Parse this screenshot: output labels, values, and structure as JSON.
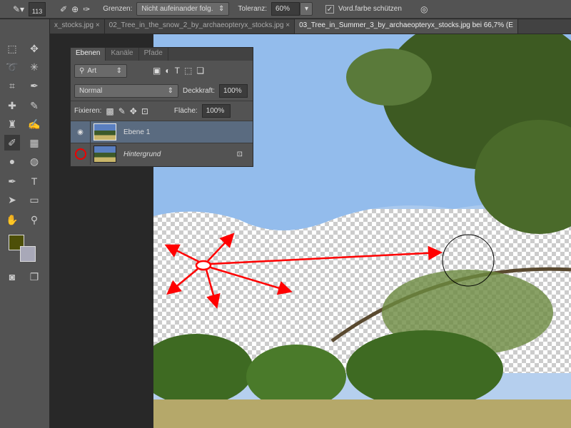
{
  "options_bar": {
    "brush_size": "113",
    "grenzen_label": "Grenzen:",
    "grenzen_value": "Nicht aufeinander folg.",
    "toleranz_label": "Toleranz:",
    "toleranz_value": "60%",
    "protect_label": "Vord.farbe schützen",
    "protect_checked": true
  },
  "doc_tabs": [
    {
      "label": "x_stocks.jpg"
    },
    {
      "label": "02_Tree_in_the_snow_2_by_archaeopteryx_stocks.jpg"
    },
    {
      "label": "03_Tree_in_Summer_3_by_archaeopteryx_stocks.jpg bei 66,7% (E"
    }
  ],
  "layers_panel": {
    "tabs": [
      "Ebenen",
      "Kanäle",
      "Pfade"
    ],
    "filter": "Art",
    "blend_mode": "Normal",
    "opacity_label": "Deckkraft:",
    "opacity": "100%",
    "lock_label": "Fixieren:",
    "fill_label": "Fläche:",
    "fill": "100%",
    "layers": [
      {
        "name": "Ebene 1",
        "visible": true,
        "selected": true
      },
      {
        "name": "Hintergrund",
        "visible": false,
        "locked": true
      }
    ]
  },
  "colors": {
    "foreground": "#4d4f08",
    "background": "#a8a8b8",
    "annotation": "#ff0000"
  }
}
